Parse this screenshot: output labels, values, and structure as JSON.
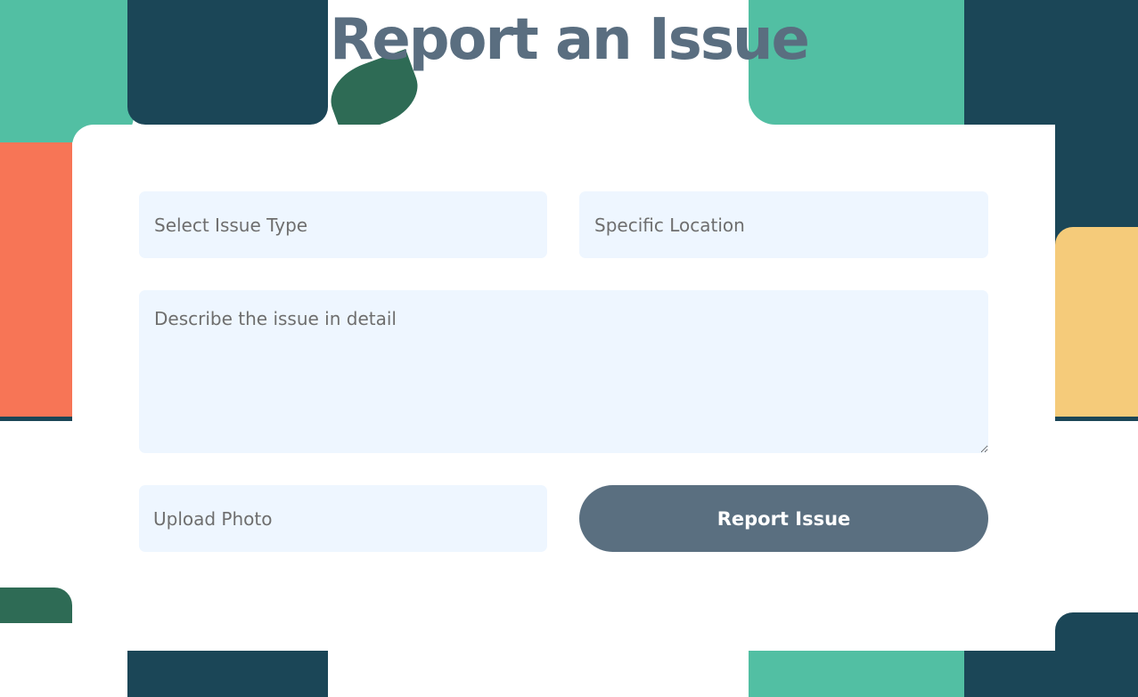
{
  "page": {
    "title": "Report an Issue"
  },
  "form": {
    "issue_type_placeholder": "Select Issue Type",
    "location_placeholder": "Specific Location",
    "description_placeholder": "Describe the issue in detail",
    "upload_placeholder": "Upload Photo",
    "submit_label": "Report Issue"
  },
  "colors": {
    "accent": "#5a6f80",
    "field_bg": "#eef6ff",
    "puzzle_teal": "#52bfa3",
    "puzzle_navy": "#1b4657",
    "puzzle_orange": "#f77556",
    "puzzle_yellow": "#f5cb7a"
  }
}
